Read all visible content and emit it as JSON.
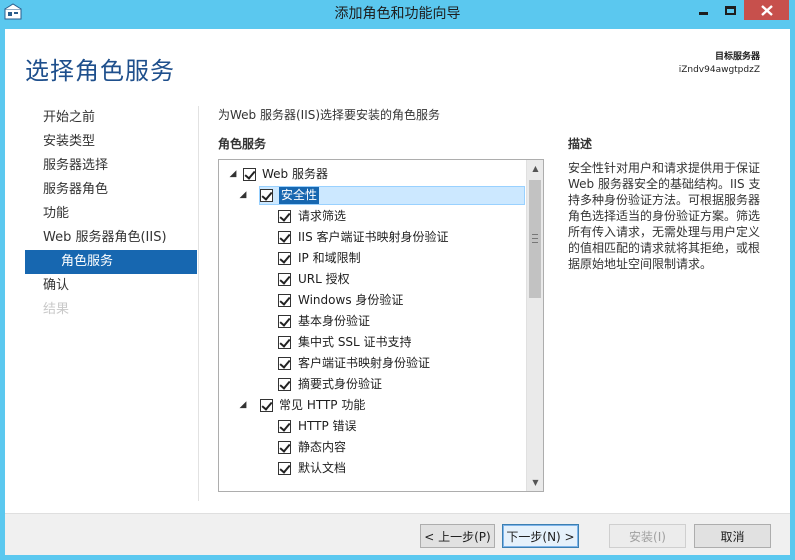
{
  "window": {
    "title": "添加角色和功能向导"
  },
  "header": {
    "page_title": "选择角色服务",
    "dest_label": "目标服务器",
    "dest_server": "iZndv94awgtpdzZ"
  },
  "nav": {
    "items": [
      {
        "label": "开始之前",
        "state": "normal"
      },
      {
        "label": "安装类型",
        "state": "normal"
      },
      {
        "label": "服务器选择",
        "state": "normal"
      },
      {
        "label": "服务器角色",
        "state": "normal"
      },
      {
        "label": "功能",
        "state": "normal"
      },
      {
        "label": "Web 服务器角色(IIS)",
        "state": "normal"
      },
      {
        "label": "角色服务",
        "state": "active"
      },
      {
        "label": "确认",
        "state": "normal"
      },
      {
        "label": "结果",
        "state": "disabled"
      }
    ]
  },
  "main": {
    "instruction": "为Web 服务器(IIS)选择要安装的角色服务",
    "roles_header": "角色服务",
    "desc_header": "描述",
    "description": "安全性针对用户和请求提供用于保证 Web 服务器安全的基础结构。IIS 支持多种身份验证方法。可根据服务器角色选择适当的身份验证方案。筛选所有传入请求，无需处理与用户定义的值相匹配的请求就将其拒绝，或根据原始地址空间限制请求。",
    "tree": [
      {
        "label": "Web 服务器",
        "level": 0,
        "expander": "◢",
        "checked": true
      },
      {
        "label": "安全性",
        "level": 1,
        "expander": "◢",
        "checked": true,
        "selected": true
      },
      {
        "label": "请求筛选",
        "level": 2,
        "checked": true
      },
      {
        "label": "IIS 客户端证书映射身份验证",
        "level": 2,
        "checked": true
      },
      {
        "label": "IP 和域限制",
        "level": 2,
        "checked": true
      },
      {
        "label": "URL 授权",
        "level": 2,
        "checked": true
      },
      {
        "label": "Windows 身份验证",
        "level": 2,
        "checked": true
      },
      {
        "label": "基本身份验证",
        "level": 2,
        "checked": true
      },
      {
        "label": "集中式 SSL 证书支持",
        "level": 2,
        "checked": true
      },
      {
        "label": "客户端证书映射身份验证",
        "level": 2,
        "checked": true
      },
      {
        "label": "摘要式身份验证",
        "level": 2,
        "checked": true
      },
      {
        "label": "常见 HTTP 功能",
        "level": 1,
        "expander": "◢",
        "checked": true
      },
      {
        "label": "HTTP 错误",
        "level": 2,
        "checked": true
      },
      {
        "label": "静态内容",
        "level": 2,
        "checked": true
      },
      {
        "label": "默认文档",
        "level": 2,
        "checked": true
      }
    ]
  },
  "footer": {
    "prev": "< 上一步(P)",
    "next": "下一步(N) >",
    "install": "安装(I)",
    "cancel": "取消"
  }
}
